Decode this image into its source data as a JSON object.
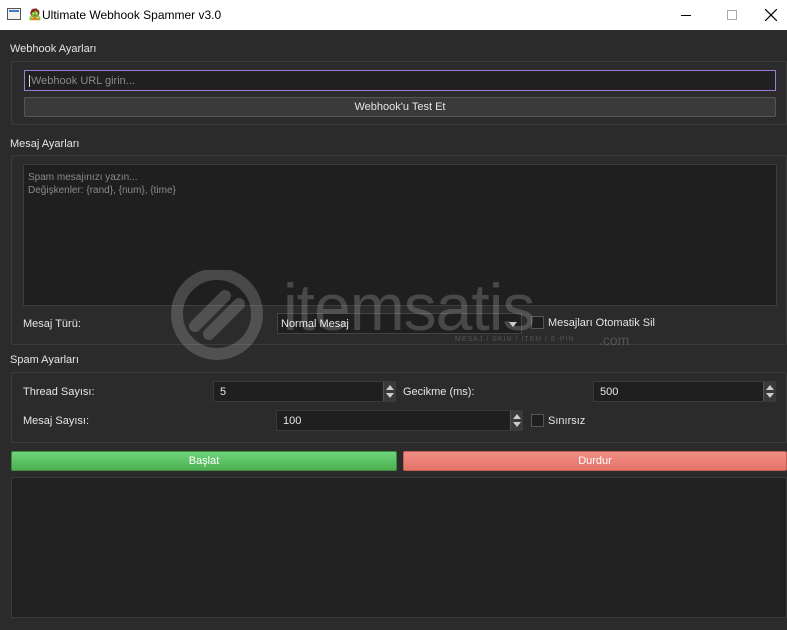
{
  "window": {
    "title_emoji": "🧟",
    "title": "Ultimate Webhook Spammer v3.0"
  },
  "webhook_group": {
    "title": "Webhook Ayarları",
    "url_placeholder": "Webhook URL girin...",
    "test_button": "Webhook'u Test Et"
  },
  "message_group": {
    "title": "Mesaj Ayarları",
    "placeholder_line1": "Spam mesajınızı yazın...",
    "placeholder_line2": "Değişkenler: {rand}, {num}, {time}",
    "type_label": "Mesaj Türü:",
    "type_value": "Normal Mesaj",
    "auto_delete_label": "Mesajları Otomatik Sil"
  },
  "spam_group": {
    "title": "Spam Ayarları",
    "thread_label": "Thread Sayısı:",
    "thread_value": "5",
    "delay_label": "Gecikme (ms):",
    "delay_value": "500",
    "count_label": "Mesaj Sayısı:",
    "count_value": "100",
    "unlimited_label": "Sınırsız"
  },
  "actions": {
    "start": "Başlat",
    "stop": "Durdur"
  },
  "watermark": {
    "text": "itemsatis",
    "sub": "MESAJ / SKIN / ITEM / E-PIN",
    "suffix": ".com"
  },
  "colors": {
    "start": "#5cc166",
    "stop": "#eb8077",
    "focus": "#a07ad8"
  }
}
